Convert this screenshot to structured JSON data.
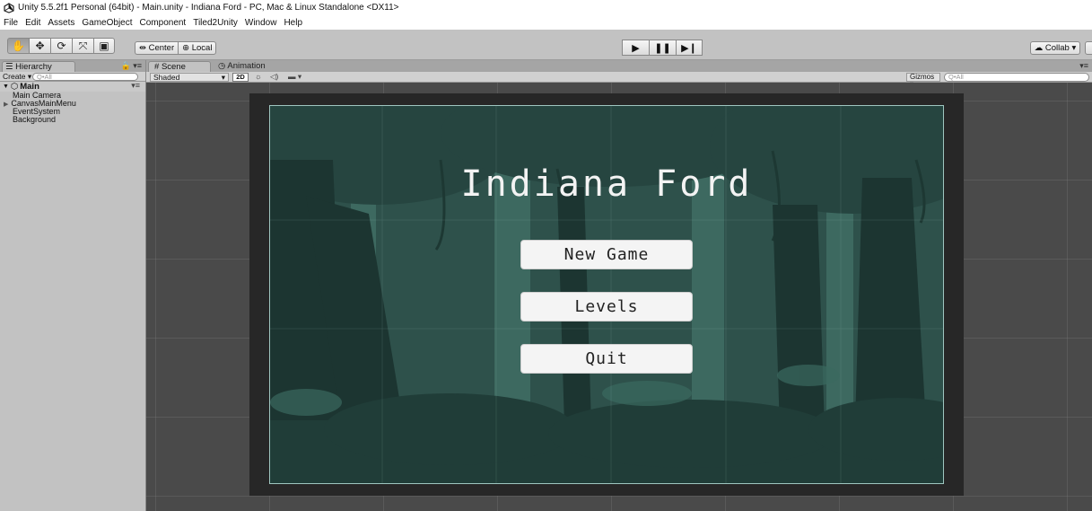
{
  "window": {
    "title": "Unity 5.5.2f1 Personal (64bit) - Main.unity - Indiana Ford - PC, Mac & Linux Standalone <DX11>"
  },
  "menu": [
    "File",
    "Edit",
    "Assets",
    "GameObject",
    "Component",
    "Tiled2Unity",
    "Window",
    "Help"
  ],
  "toolbar": {
    "tools": [
      "hand-tool",
      "move-tool",
      "rotate-tool",
      "scale-tool",
      "rect-tool"
    ],
    "pivot_label": "Center",
    "space_label": "Local",
    "collab_label": "Collab"
  },
  "hierarchy": {
    "tab_label": "Hierarchy",
    "create_label": "Create",
    "search_placeholder": "Q•All",
    "scene_name": "Main",
    "items": [
      {
        "label": "Main Camera",
        "expandable": false
      },
      {
        "label": "CanvasMainMenu",
        "expandable": true
      },
      {
        "label": "EventSystem",
        "expandable": false
      },
      {
        "label": "Background",
        "expandable": false
      }
    ]
  },
  "scene": {
    "tab_scene": "Scene",
    "tab_animation": "Animation",
    "shading_mode": "Shaded",
    "mode_2d": "2D",
    "gizmos_label": "Gizmos",
    "search_placeholder": "Q•All"
  },
  "game": {
    "title": "Indiana Ford",
    "buttons": [
      "New Game",
      "Levels",
      "Quit"
    ],
    "colors": {
      "background": "#2c4c47",
      "foliage_dark": "#1f3a35",
      "foliage_mid": "#3d6a60",
      "button_bg": "#f4f4f4"
    }
  }
}
